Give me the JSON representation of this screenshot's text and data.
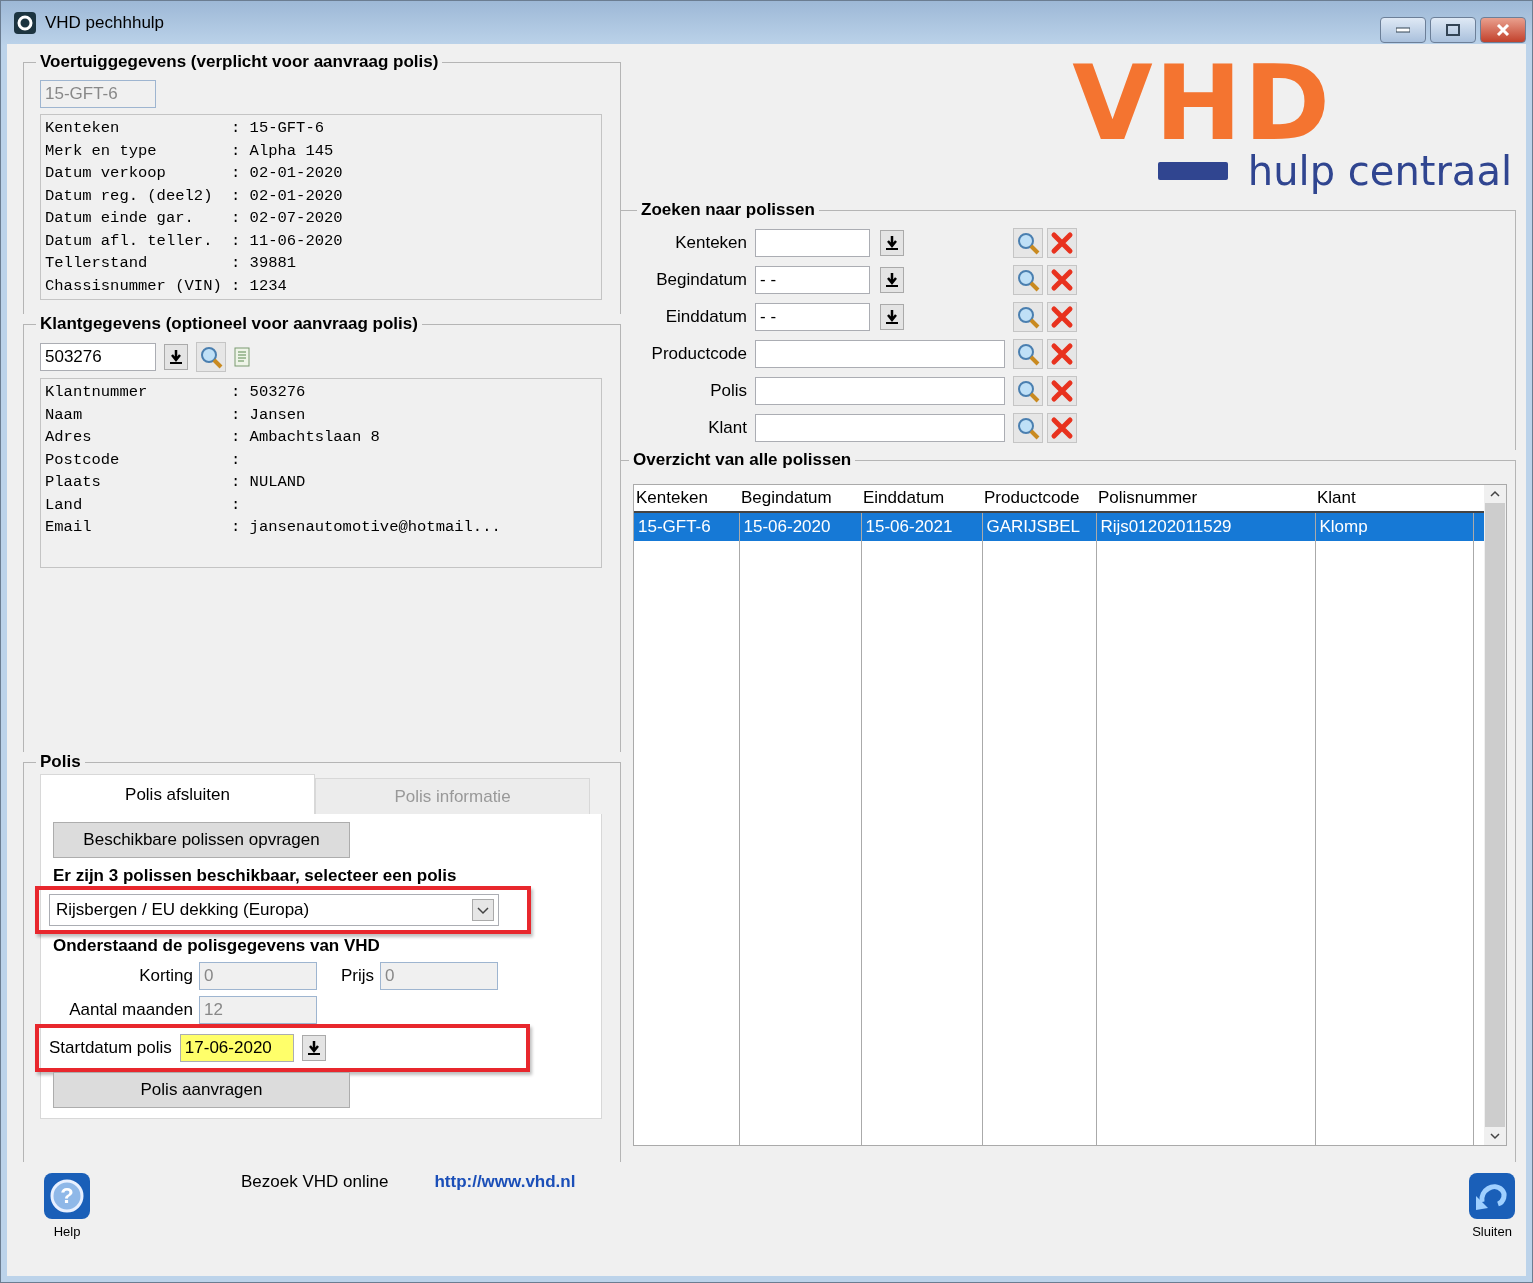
{
  "window": {
    "title": "VHD pechhhulp"
  },
  "vehicle": {
    "title": "Voertuiggegevens (verplicht voor aanvraag polis)",
    "plate": {
      "value": "15-GFT-6",
      "disabled": true
    },
    "lines": [
      {
        "label": "Kenteken",
        "separator": ":",
        "value": "15-GFT-6"
      },
      {
        "label": "Merk en type",
        "separator": ":",
        "value": "Alpha 145"
      },
      {
        "label": "Datum verkoop",
        "separator": ":",
        "value": "02-01-2020"
      },
      {
        "label": "Datum reg. (deel2)",
        "separator": ":",
        "value": "02-01-2020"
      },
      {
        "label": "Datum einde gar.",
        "separator": ":",
        "value": "02-07-2020"
      },
      {
        "label": "Datum afl. teller.",
        "separator": ":",
        "value": "11-06-2020"
      },
      {
        "label": "Tellerstand",
        "separator": ":",
        "value": "39881"
      },
      {
        "label": "Chassisnummer (VIN)",
        "separator": ":",
        "value": "1234"
      }
    ]
  },
  "customer": {
    "title": "Klantgegevens (optioneel voor aanvraag polis)",
    "number": {
      "value": "503276",
      "disabled": false
    },
    "lines": [
      {
        "label": "Klantnummer",
        "separator": ":",
        "value": "503276"
      },
      {
        "label": "Naam",
        "separator": ":",
        "value": "Jansen"
      },
      {
        "label": "Adres",
        "separator": ":",
        "value": "Ambachtslaan 8"
      },
      {
        "label": "Postcode",
        "separator": ":"
      },
      {
        "label": "Plaats",
        "separator": ":",
        "value": "NULAND"
      },
      {
        "label": "Land",
        "separator": ":"
      },
      {
        "label": "Email",
        "separator": ":",
        "value": "jansenautomotive@hotmail..."
      }
    ]
  },
  "policy": {
    "title": "Polis",
    "tabs": [
      {
        "label": "Polis afsluiten",
        "selected": true
      },
      {
        "label": "Polis informatie",
        "selected": false
      }
    ],
    "request_button": "Beschikbare polissen opvragen",
    "available_message": "Er zijn 3 polissen beschikbaar, selecteer een polis",
    "policy_select": {
      "value": "Rijsbergen / EU dekking (Europa)",
      "highlighted": true
    },
    "details_title": "Onderstaand de polisgegevens van VHD",
    "korting": {
      "label": "Korting",
      "value": "0",
      "disabled": true
    },
    "prijs": {
      "label": "Prijs",
      "value": "0",
      "disabled": true
    },
    "months": {
      "label": "Aantal maanden",
      "value": "12",
      "disabled": true
    },
    "start_date": {
      "label": "Startdatum polis",
      "value": "17-06-2020",
      "highlighted": true
    },
    "submit_button": "Polis aanvragen"
  },
  "logo": {
    "brand": "VHD",
    "tagline": "hulp centraal"
  },
  "search": {
    "title": "Zoeken naar polissen",
    "fields": [
      {
        "label": "Kenteken",
        "kind": "short"
      },
      {
        "label": "Begindatum",
        "placeholder": "- -",
        "kind": "short"
      },
      {
        "label": "Einddatum",
        "placeholder": "- -",
        "kind": "short"
      },
      {
        "label": "Productcode",
        "kind": "long"
      },
      {
        "label": "Polis",
        "kind": "long"
      },
      {
        "label": "Klant",
        "kind": "long"
      }
    ]
  },
  "overview": {
    "title": "Overzicht van alle polissen",
    "columns": [
      "Kenteken",
      "Begindatum",
      "Einddatum",
      "Productcode",
      "Polisnummer",
      "Klant"
    ],
    "rows": [
      {
        "cells": [
          "15-GFT-6",
          "15-06-2020",
          "15-06-2021",
          "GARIJSBEL",
          "Rijs01202011529",
          "Klomp"
        ],
        "selected": true
      }
    ]
  },
  "footer": {
    "help_glyph": "?",
    "help_label": "Help",
    "visit_text": "Bezoek VHD online",
    "link": "http://www.vhd.nl",
    "close_label": "Sluiten"
  }
}
